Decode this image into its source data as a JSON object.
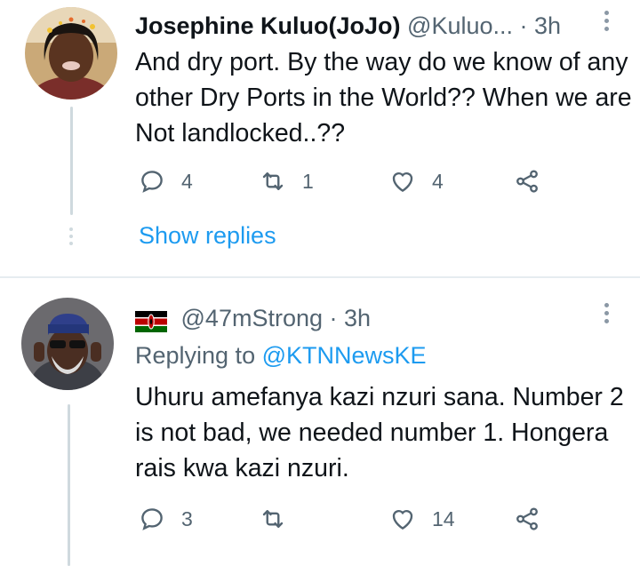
{
  "tweets": [
    {
      "name": "Josephine Kuluo(JoJo)",
      "handle": "@Kuluo...",
      "time": "· 3h",
      "text": "And dry port. By the way do we know of any other Dry Ports in the World?? When we are Not landlocked..??",
      "replies": "4",
      "retweets": "1",
      "likes": "4",
      "show_replies": "Show replies"
    },
    {
      "flag": "kenya-flag-icon",
      "handle": "@47mStrong",
      "time": "· 3h",
      "replying_prefix": "Replying to",
      "replying_to": "@KTNNewsKE",
      "text": "Uhuru amefanya kazi nzuri sana. Number 2 is not  bad, we needed number 1. Hongera rais kwa kazi nzuri.",
      "replies": "3",
      "retweets": "",
      "likes": "14"
    }
  ],
  "colors": {
    "link": "#1d9bf0",
    "secondary_text": "#536471",
    "thread_line": "#cfd9de"
  }
}
